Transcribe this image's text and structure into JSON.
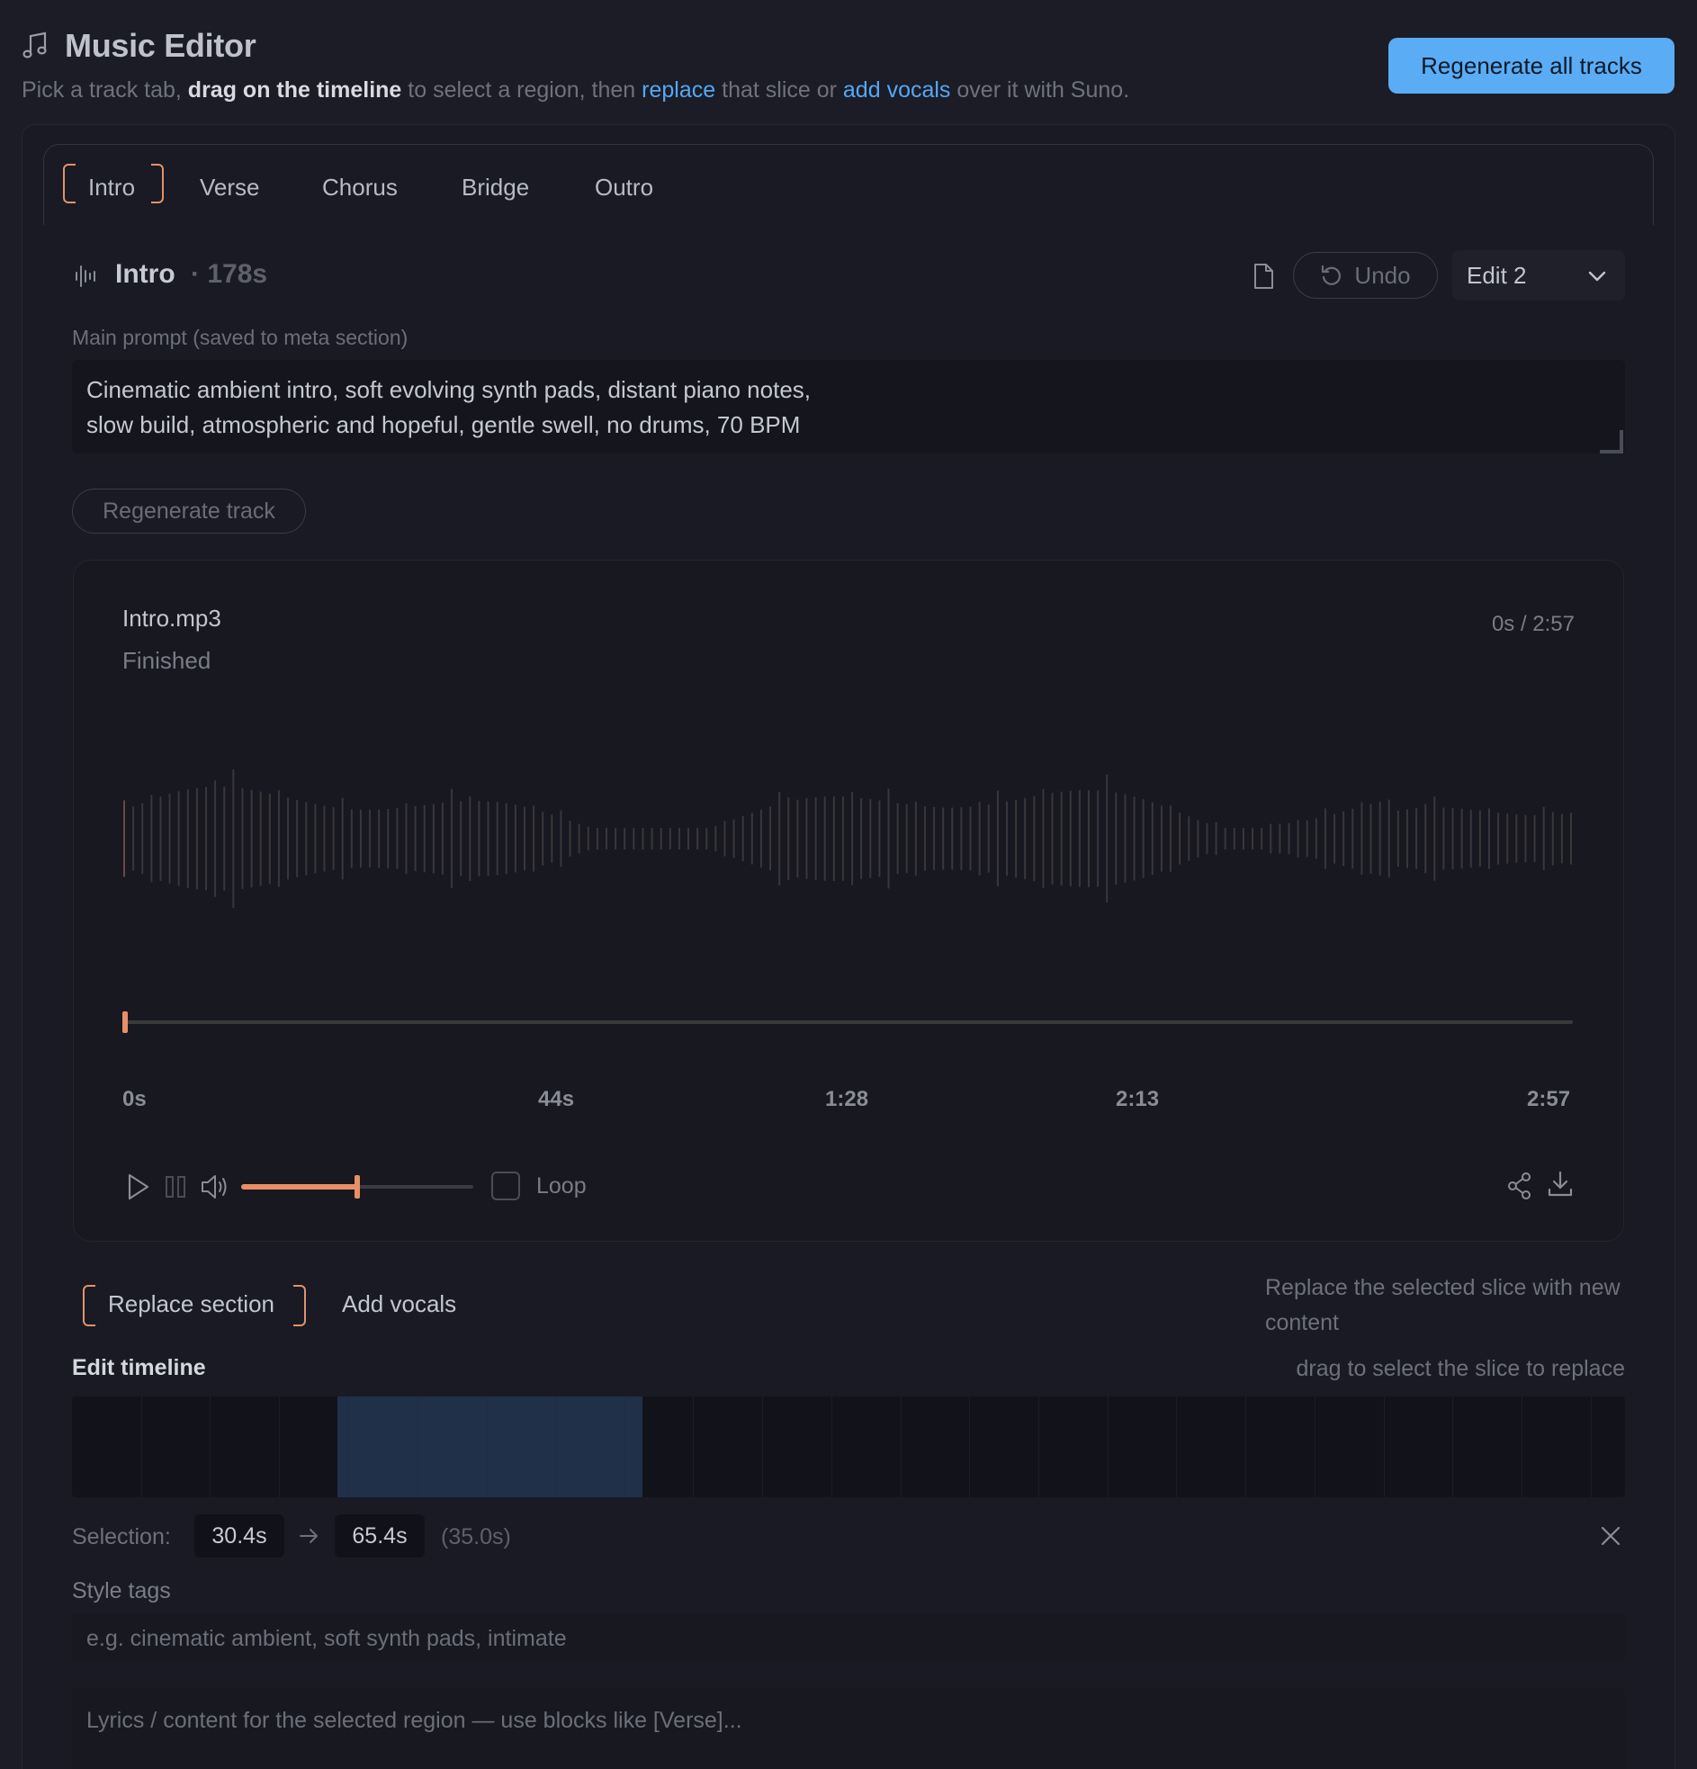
{
  "header": {
    "title": "Music Editor",
    "subtitle": {
      "p1": "Pick a track tab, ",
      "b1": "drag on the timeline",
      "p2": " to select a region, then ",
      "l1": "replace",
      "p3": " that slice or ",
      "l2": "add vocals",
      "p4": " over it with Suno."
    },
    "regenerate_all_label": "Regenerate all tracks"
  },
  "tabs": [
    {
      "label": "Intro",
      "active": true
    },
    {
      "label": "Verse",
      "active": false
    },
    {
      "label": "Chorus",
      "active": false
    },
    {
      "label": "Bridge",
      "active": false
    },
    {
      "label": "Outro",
      "active": false
    }
  ],
  "track": {
    "name": "Intro",
    "duration": "· 178s",
    "undo_label": "Undo",
    "edit_version": "Edit 2",
    "prompt_label": "Main prompt (saved to meta section)",
    "prompt_line1": "Cinematic ambient intro, soft evolving synth pads, distant piano notes,",
    "prompt_line2": "slow build, atmospheric and hopeful, gentle swell, no drums, 70 BPM",
    "regenerate_label": "Regenerate track"
  },
  "player": {
    "file_name": "Intro.mp3",
    "status": "Finished",
    "time_readout": "0s / 2:57",
    "progress": 0,
    "ticks": [
      "0s",
      "44s",
      "1:28",
      "2:13",
      "2:57"
    ],
    "volume": 0.5,
    "loop_label": "Loop",
    "loop_checked": false
  },
  "modes": {
    "replace_label": "Replace section",
    "vocals_label": "Add vocals",
    "active": "replace",
    "hint": "Replace the selected slice with new content"
  },
  "timeline": {
    "label": "Edit timeline",
    "hint": "drag to select the slice to replace",
    "total_seconds": 178,
    "selection_start_seconds": 30.4,
    "selection_end_seconds": 65.4
  },
  "selection": {
    "label": "Selection:",
    "start": "30.4s",
    "end": "65.4s",
    "length": "(35.0s)"
  },
  "style": {
    "label": "Style tags",
    "placeholder": "e.g. cinematic ambient, soft synth pads, intimate"
  },
  "lyrics": {
    "placeholder": "Lyrics / content for the selected region — use blocks like [Verse]..."
  },
  "colors": {
    "accent": "#e98f66",
    "primary_button": "#5aacf5",
    "link": "#55a7f5",
    "selection": "#213049"
  }
}
